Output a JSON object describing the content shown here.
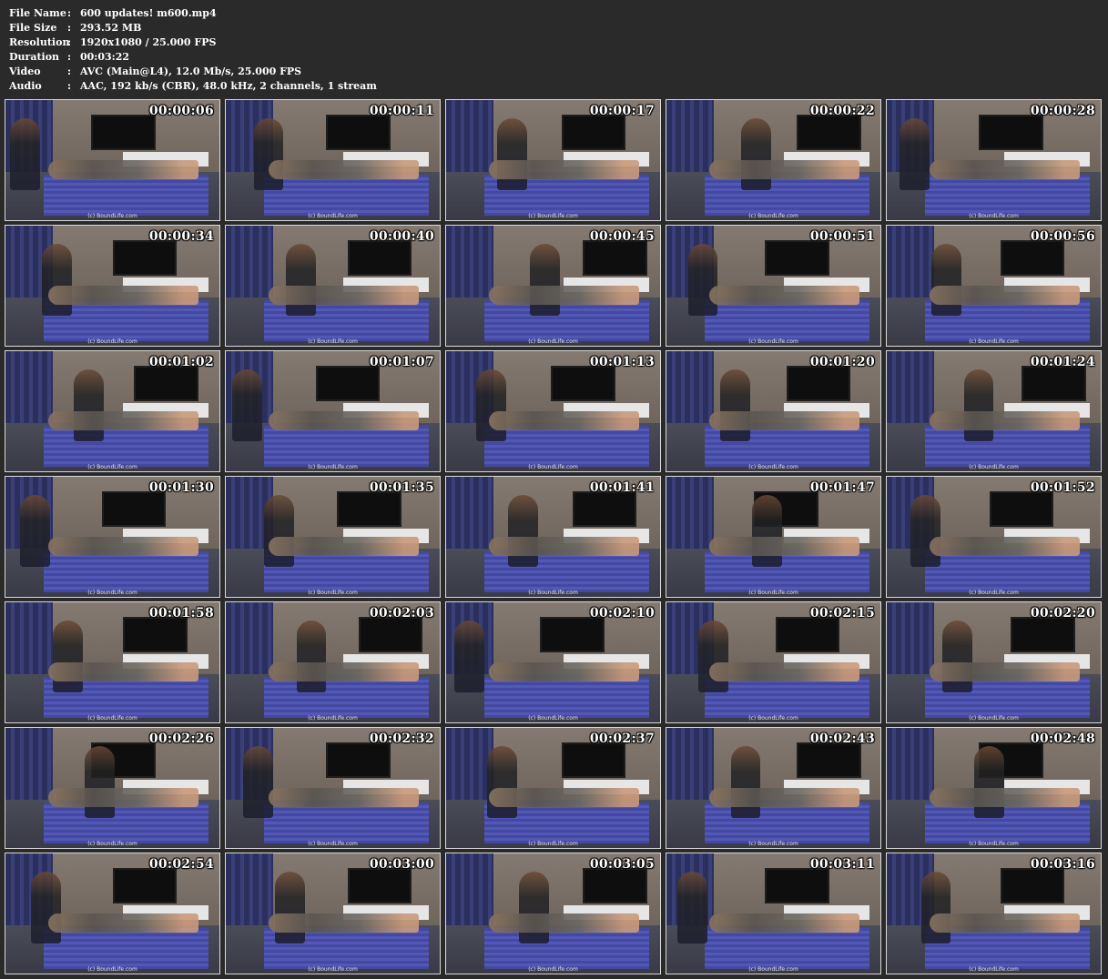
{
  "info": {
    "rows": [
      {
        "key": "File Name",
        "value": "600 updates! m600.mp4"
      },
      {
        "key": "File Size",
        "value": "293.52 MB"
      },
      {
        "key": "Resolution",
        "value": "1920x1080 / 25.000 FPS"
      },
      {
        "key": "Duration",
        "value": "00:03:22"
      },
      {
        "key": "Video",
        "value": "AVC (Main@L4), 12.0 Mb/s, 25.000 FPS"
      },
      {
        "key": "Audio",
        "value": "AAC, 192 kb/s (CBR), 48.0 kHz, 2 channels, 1 stream"
      }
    ]
  },
  "separator": ":",
  "watermark": "(c) BoundLife.com",
  "thumbnails": [
    "00:00:06",
    "00:00:11",
    "00:00:17",
    "00:00:22",
    "00:00:28",
    "00:00:34",
    "00:00:40",
    "00:00:45",
    "00:00:51",
    "00:00:56",
    "00:01:02",
    "00:01:07",
    "00:01:13",
    "00:01:20",
    "00:01:24",
    "00:01:30",
    "00:01:35",
    "00:01:41",
    "00:01:47",
    "00:01:52",
    "00:01:58",
    "00:02:03",
    "00:02:10",
    "00:02:15",
    "00:02:20",
    "00:02:26",
    "00:02:32",
    "00:02:37",
    "00:02:43",
    "00:02:48",
    "00:02:54",
    "00:03:00",
    "00:03:05",
    "00:03:11",
    "00:03:16"
  ]
}
